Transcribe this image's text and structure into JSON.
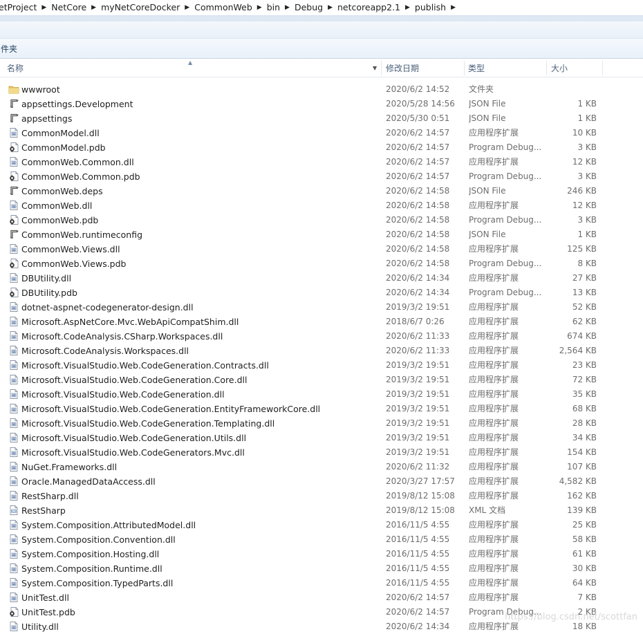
{
  "breadcrumb": [
    "etProject",
    "NetCore",
    "myNetCoreDocker",
    "CommonWeb",
    "bin",
    "Debug",
    "netcoreapp2.1",
    "publish"
  ],
  "toolbar": {
    "label": "件夹"
  },
  "columns": {
    "name": "名称",
    "date": "修改日期",
    "type": "类型",
    "size": "大小"
  },
  "files": [
    {
      "name": "wwwroot",
      "date": "2020/6/2 14:52",
      "type": "文件夹",
      "size": "",
      "icon": "folder-icon"
    },
    {
      "name": "appsettings.Development",
      "date": "2020/5/28 14:56",
      "type": "JSON File",
      "size": "1 KB",
      "icon": "json-file-icon"
    },
    {
      "name": "appsettings",
      "date": "2020/5/30 0:51",
      "type": "JSON File",
      "size": "1 KB",
      "icon": "json-file-icon"
    },
    {
      "name": "CommonModel.dll",
      "date": "2020/6/2 14:57",
      "type": "应用程序扩展",
      "size": "10 KB",
      "icon": "dll-file-icon"
    },
    {
      "name": "CommonModel.pdb",
      "date": "2020/6/2 14:57",
      "type": "Program Debug...",
      "size": "3 KB",
      "icon": "pdb-file-icon"
    },
    {
      "name": "CommonWeb.Common.dll",
      "date": "2020/6/2 14:57",
      "type": "应用程序扩展",
      "size": "12 KB",
      "icon": "dll-file-icon"
    },
    {
      "name": "CommonWeb.Common.pdb",
      "date": "2020/6/2 14:57",
      "type": "Program Debug...",
      "size": "3 KB",
      "icon": "pdb-file-icon"
    },
    {
      "name": "CommonWeb.deps",
      "date": "2020/6/2 14:58",
      "type": "JSON File",
      "size": "246 KB",
      "icon": "json-file-icon"
    },
    {
      "name": "CommonWeb.dll",
      "date": "2020/6/2 14:58",
      "type": "应用程序扩展",
      "size": "12 KB",
      "icon": "dll-file-icon"
    },
    {
      "name": "CommonWeb.pdb",
      "date": "2020/6/2 14:58",
      "type": "Program Debug...",
      "size": "3 KB",
      "icon": "pdb-file-icon"
    },
    {
      "name": "CommonWeb.runtimeconfig",
      "date": "2020/6/2 14:58",
      "type": "JSON File",
      "size": "1 KB",
      "icon": "json-file-icon"
    },
    {
      "name": "CommonWeb.Views.dll",
      "date": "2020/6/2 14:58",
      "type": "应用程序扩展",
      "size": "125 KB",
      "icon": "dll-file-icon"
    },
    {
      "name": "CommonWeb.Views.pdb",
      "date": "2020/6/2 14:58",
      "type": "Program Debug...",
      "size": "8 KB",
      "icon": "pdb-file-icon"
    },
    {
      "name": "DBUtility.dll",
      "date": "2020/6/2 14:34",
      "type": "应用程序扩展",
      "size": "27 KB",
      "icon": "dll-file-icon"
    },
    {
      "name": "DBUtility.pdb",
      "date": "2020/6/2 14:34",
      "type": "Program Debug...",
      "size": "13 KB",
      "icon": "pdb-file-icon"
    },
    {
      "name": "dotnet-aspnet-codegenerator-design.dll",
      "date": "2019/3/2 19:51",
      "type": "应用程序扩展",
      "size": "52 KB",
      "icon": "dll-file-icon"
    },
    {
      "name": "Microsoft.AspNetCore.Mvc.WebApiCompatShim.dll",
      "date": "2018/6/7 0:26",
      "type": "应用程序扩展",
      "size": "62 KB",
      "icon": "dll-file-icon"
    },
    {
      "name": "Microsoft.CodeAnalysis.CSharp.Workspaces.dll",
      "date": "2020/6/2 11:33",
      "type": "应用程序扩展",
      "size": "674 KB",
      "icon": "dll-file-icon"
    },
    {
      "name": "Microsoft.CodeAnalysis.Workspaces.dll",
      "date": "2020/6/2 11:33",
      "type": "应用程序扩展",
      "size": "2,564 KB",
      "icon": "dll-file-icon"
    },
    {
      "name": "Microsoft.VisualStudio.Web.CodeGeneration.Contracts.dll",
      "date": "2019/3/2 19:51",
      "type": "应用程序扩展",
      "size": "23 KB",
      "icon": "dll-file-icon"
    },
    {
      "name": "Microsoft.VisualStudio.Web.CodeGeneration.Core.dll",
      "date": "2019/3/2 19:51",
      "type": "应用程序扩展",
      "size": "72 KB",
      "icon": "dll-file-icon"
    },
    {
      "name": "Microsoft.VisualStudio.Web.CodeGeneration.dll",
      "date": "2019/3/2 19:51",
      "type": "应用程序扩展",
      "size": "35 KB",
      "icon": "dll-file-icon"
    },
    {
      "name": "Microsoft.VisualStudio.Web.CodeGeneration.EntityFrameworkCore.dll",
      "date": "2019/3/2 19:51",
      "type": "应用程序扩展",
      "size": "68 KB",
      "icon": "dll-file-icon"
    },
    {
      "name": "Microsoft.VisualStudio.Web.CodeGeneration.Templating.dll",
      "date": "2019/3/2 19:51",
      "type": "应用程序扩展",
      "size": "28 KB",
      "icon": "dll-file-icon"
    },
    {
      "name": "Microsoft.VisualStudio.Web.CodeGeneration.Utils.dll",
      "date": "2019/3/2 19:51",
      "type": "应用程序扩展",
      "size": "34 KB",
      "icon": "dll-file-icon"
    },
    {
      "name": "Microsoft.VisualStudio.Web.CodeGenerators.Mvc.dll",
      "date": "2019/3/2 19:51",
      "type": "应用程序扩展",
      "size": "154 KB",
      "icon": "dll-file-icon"
    },
    {
      "name": "NuGet.Frameworks.dll",
      "date": "2020/6/2 11:32",
      "type": "应用程序扩展",
      "size": "107 KB",
      "icon": "dll-file-icon"
    },
    {
      "name": "Oracle.ManagedDataAccess.dll",
      "date": "2020/3/27 17:57",
      "type": "应用程序扩展",
      "size": "4,582 KB",
      "icon": "dll-file-icon"
    },
    {
      "name": "RestSharp.dll",
      "date": "2019/8/12 15:08",
      "type": "应用程序扩展",
      "size": "162 KB",
      "icon": "dll-file-icon"
    },
    {
      "name": "RestSharp",
      "date": "2019/8/12 15:08",
      "type": "XML 文档",
      "size": "139 KB",
      "icon": "xml-file-icon"
    },
    {
      "name": "System.Composition.AttributedModel.dll",
      "date": "2016/11/5 4:55",
      "type": "应用程序扩展",
      "size": "25 KB",
      "icon": "dll-file-icon"
    },
    {
      "name": "System.Composition.Convention.dll",
      "date": "2016/11/5 4:55",
      "type": "应用程序扩展",
      "size": "58 KB",
      "icon": "dll-file-icon"
    },
    {
      "name": "System.Composition.Hosting.dll",
      "date": "2016/11/5 4:55",
      "type": "应用程序扩展",
      "size": "61 KB",
      "icon": "dll-file-icon"
    },
    {
      "name": "System.Composition.Runtime.dll",
      "date": "2016/11/5 4:55",
      "type": "应用程序扩展",
      "size": "30 KB",
      "icon": "dll-file-icon"
    },
    {
      "name": "System.Composition.TypedParts.dll",
      "date": "2016/11/5 4:55",
      "type": "应用程序扩展",
      "size": "64 KB",
      "icon": "dll-file-icon"
    },
    {
      "name": "UnitTest.dll",
      "date": "2020/6/2 14:57",
      "type": "应用程序扩展",
      "size": "7 KB",
      "icon": "dll-file-icon"
    },
    {
      "name": "UnitTest.pdb",
      "date": "2020/6/2 14:57",
      "type": "Program Debug...",
      "size": "2 KB",
      "icon": "pdb-file-icon"
    },
    {
      "name": "Utility.dll",
      "date": "2020/6/2 14:34",
      "type": "应用程序扩展",
      "size": "18 KB",
      "icon": "dll-file-icon"
    }
  ],
  "watermark": "https://blog.csdn.net/scottfan"
}
